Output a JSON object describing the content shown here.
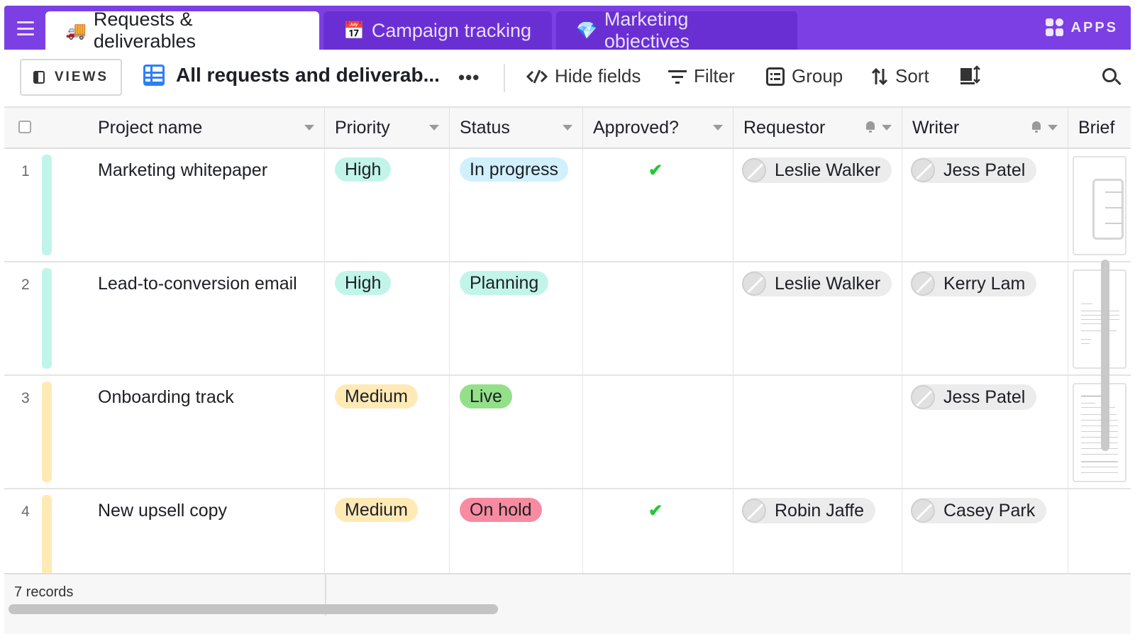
{
  "tabs": [
    {
      "emoji": "🚚",
      "label": "Requests & deliverables"
    },
    {
      "emoji": "📅",
      "label": "Campaign tracking"
    },
    {
      "emoji": "💎",
      "label": "Marketing objectives"
    }
  ],
  "apps_label": "APPS",
  "toolbar": {
    "views_label": "VIEWS",
    "view_name": "All requests and deliverab...",
    "more": "•••",
    "hide_fields": "Hide fields",
    "filter": "Filter",
    "group": "Group",
    "sort": "Sort"
  },
  "columns": [
    "Project name",
    "Priority",
    "Status",
    "Approved?",
    "Requestor",
    "Writer",
    "Brief"
  ],
  "rows": [
    {
      "num": "1",
      "project": "Marketing whitepaper",
      "priority": "High",
      "status": "In progress",
      "approved": true,
      "requestor": "Leslie Walker",
      "writer": "Jess Patel",
      "bar_color": "#c2f5e9"
    },
    {
      "num": "2",
      "project": "Lead-to-conversion email",
      "priority": "High",
      "status": "Planning",
      "approved": false,
      "requestor": "Leslie Walker",
      "writer": "Kerry Lam",
      "bar_color": "#c2f5e9"
    },
    {
      "num": "3",
      "project": "Onboarding track",
      "priority": "Medium",
      "status": "Live",
      "approved": false,
      "requestor": "",
      "writer": "Jess Patel",
      "bar_color": "#ffeab6"
    },
    {
      "num": "4",
      "project": "New upsell copy",
      "priority": "Medium",
      "status": "On hold",
      "approved": true,
      "requestor": "Robin Jaffe",
      "writer": "Casey Park",
      "bar_color": "#ffeab6"
    }
  ],
  "priority_colors": {
    "High": "#c2f5e9",
    "Medium": "#ffeab6"
  },
  "status_colors": {
    "In progress": "#d0f0fd",
    "Planning": "#c2f5e9",
    "Live": "#93e088",
    "On hold": "#f88ba1"
  },
  "check_glyph": "✔",
  "footer": {
    "records": "7 records"
  }
}
